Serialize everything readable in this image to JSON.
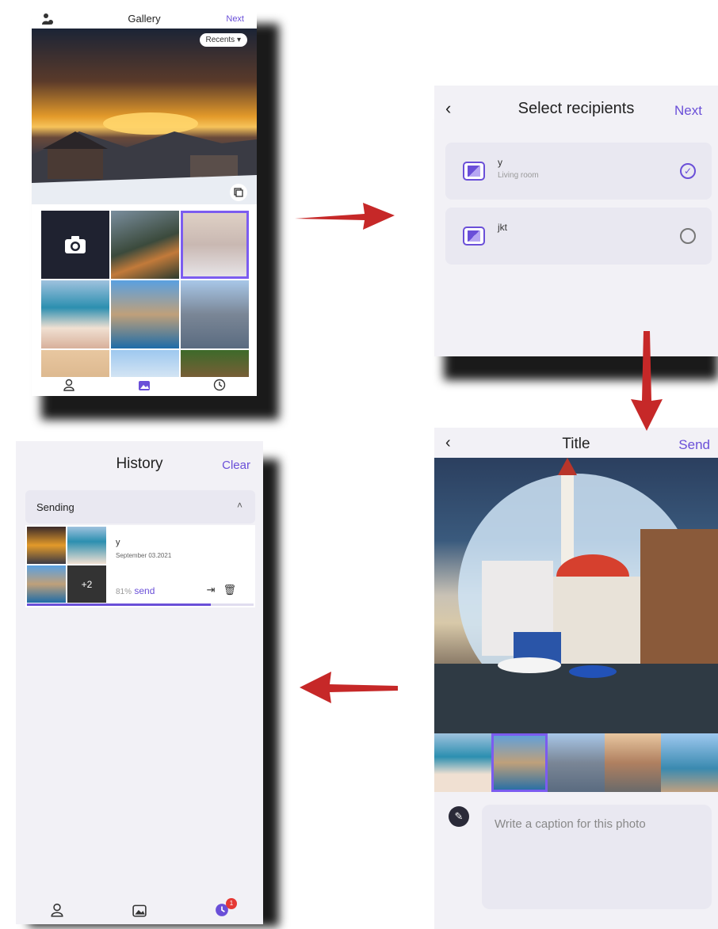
{
  "gallery": {
    "title": "Gallery",
    "next_label": "Next",
    "recents_label": "Recents"
  },
  "recipients": {
    "title": "Select recipients",
    "next_label": "Next",
    "items": [
      {
        "name": "y",
        "sublabel": "Living room",
        "selected": true
      },
      {
        "name": "jkt",
        "sublabel": "",
        "selected": false
      }
    ]
  },
  "compose": {
    "title": "Title",
    "send_label": "Send",
    "caption_placeholder": "Write a caption for this photo"
  },
  "history": {
    "title": "History",
    "clear_label": "Clear",
    "section_label": "Sending",
    "item": {
      "name": "y",
      "date": "September 03.2021",
      "percent": "81%",
      "status": "send",
      "more_count": "+2",
      "progress": 0.81
    },
    "badge_count": "1"
  },
  "colors": {
    "accent": "#6a4fd8",
    "arrow": "#c62828",
    "badge": "#e53935"
  }
}
